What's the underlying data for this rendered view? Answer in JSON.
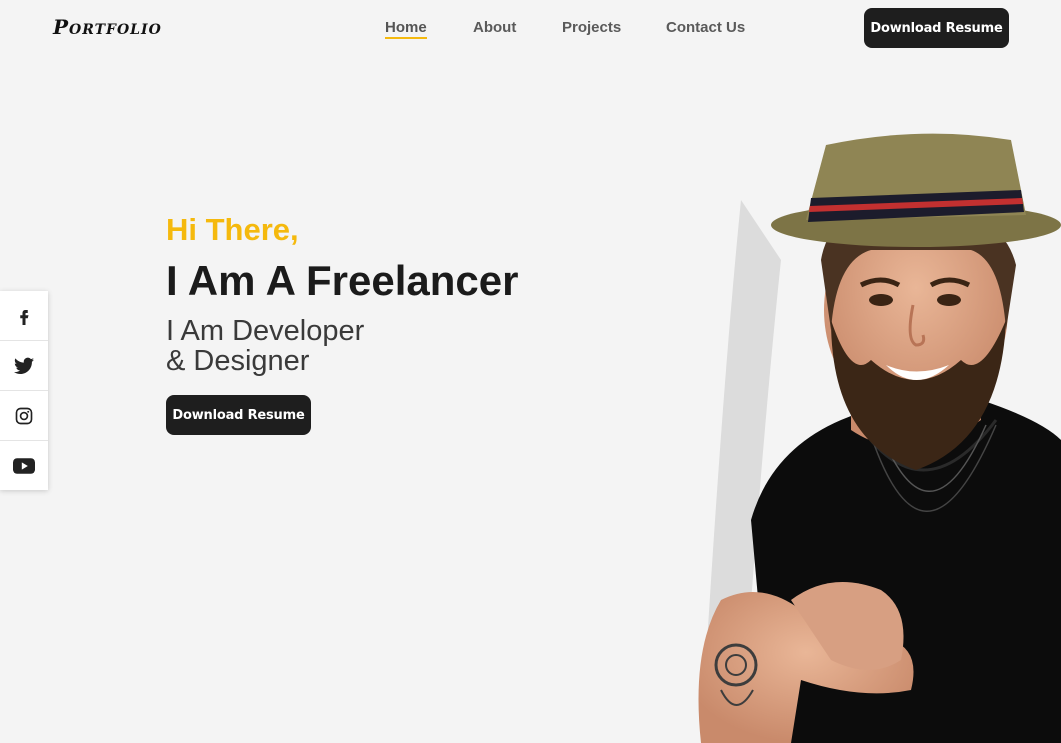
{
  "brand": {
    "logo": "Portfolio"
  },
  "nav": {
    "items": [
      {
        "label": "Home",
        "active": true
      },
      {
        "label": "About"
      },
      {
        "label": "Projects"
      },
      {
        "label": "Contact Us"
      }
    ]
  },
  "header": {
    "download_label": "Download Resume"
  },
  "hero": {
    "greeting": "Hi There,",
    "headline": "I Am A Freelancer",
    "sub_line1": "I Am Developer",
    "sub_line2": "& Designer",
    "download_label": "Download Resume"
  },
  "social": {
    "icons": [
      "facebook-icon",
      "twitter-icon",
      "instagram-icon",
      "youtube-icon"
    ]
  },
  "colors": {
    "accent": "#f5b90d",
    "button_bg": "#1e1e1e",
    "page_bg": "#f4f4f4"
  }
}
